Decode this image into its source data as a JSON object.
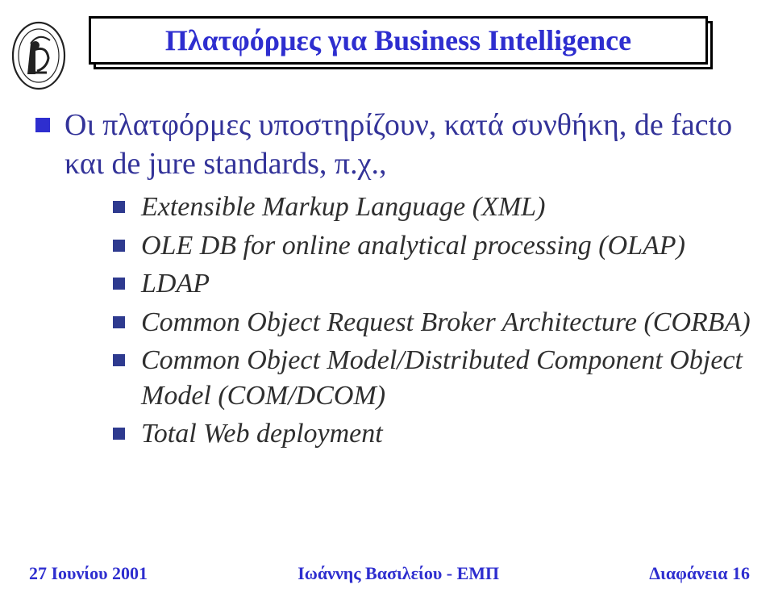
{
  "title": "Πλατφόρμες για Business Intelligence",
  "bullet_main": "Οι πλατφόρμες υποστηρίζουν, κατά συνθήκη, de facto και de jure standards, π.χ.,",
  "sub_bullets": [
    "Extensible Markup Language (XML)",
    "OLE DB for online analytical processing (OLAP)",
    "LDAP",
    "Common Object Request Broker Architecture (CORBA)",
    "Common Object Model/Distributed Component Object Model (COM/DCOM)",
    "Total Web deployment"
  ],
  "footer": {
    "left": "27  Ιουνίου  2001",
    "center": "Ιωάννης Βασιλείου - ΕΜΠ",
    "right": "Διαφάνεια 16"
  }
}
